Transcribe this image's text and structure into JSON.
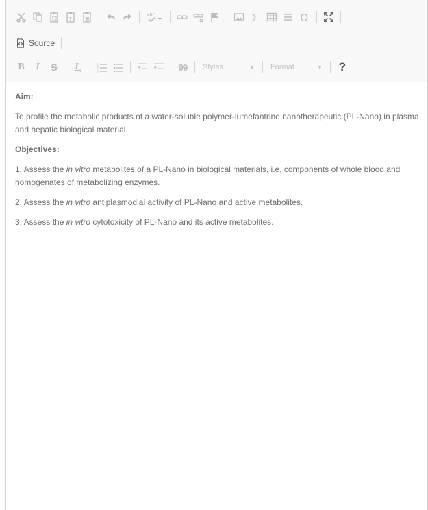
{
  "toolbar": {
    "source_label": "Source",
    "styles_placeholder": "Styles",
    "format_placeholder": "Format",
    "help_label": "?",
    "bold_label": "B",
    "italic_label": "I",
    "strike_label": "S",
    "removeformat_label": "I",
    "removeformat_sub": "x",
    "blockquote_label": "99",
    "spellcheck_label": "ABC",
    "omega_label": "Ω",
    "sigma_label": "Σ",
    "icons": [
      "cut-icon",
      "copy-icon",
      "paste-icon",
      "paste-text-icon",
      "paste-word-icon",
      "undo-icon",
      "redo-icon",
      "spellcheck-icon",
      "link-icon",
      "unlink-icon",
      "anchor-icon",
      "image-icon",
      "math-icon",
      "table-icon",
      "horizontal-rule-icon",
      "special-char-icon",
      "maximize-icon",
      "source-icon",
      "bold-icon",
      "italic-icon",
      "strike-icon",
      "remove-format-icon",
      "numbered-list-icon",
      "bulleted-list-icon",
      "outdent-icon",
      "indent-icon",
      "blockquote-icon"
    ]
  },
  "content": {
    "aim_heading": "Aim:",
    "aim_text": "To profile the metabolic products of a water-soluble polymer-lumefantrine nanotherapeutic (PL-Nano) in plasma and hepatic biological material.",
    "objectives_heading": "Objectives:",
    "obj1_prefix": "1. Assess the ",
    "obj1_italic": "in vitro",
    "obj1_suffix": " metabolites of a PL-Nano in biological materials, i.e, components of whole blood and homogenates of metabolizing enzymes.",
    "obj2_prefix": "2. Assess the ",
    "obj2_italic": "in vitro",
    "obj2_suffix": " antiplasmodial activity of PL-Nano and active metabolites.",
    "obj3_prefix": "3. Assess the ",
    "obj3_italic": "in vitro",
    "obj3_suffix": " cytotoxicity of PL-Nano and its active metabolites."
  }
}
